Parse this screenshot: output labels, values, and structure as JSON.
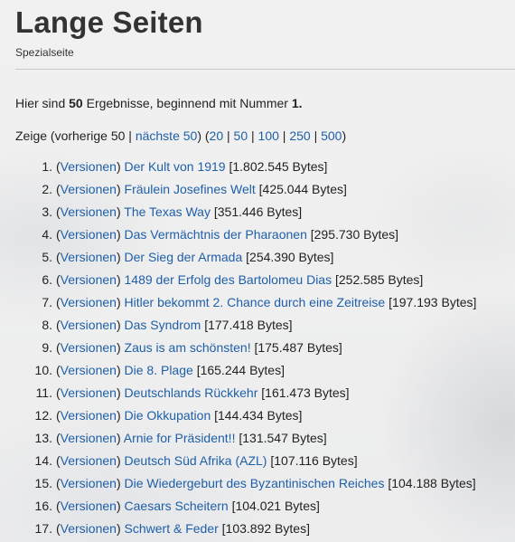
{
  "page": {
    "title": "Lange Seiten",
    "subtitle": "Spezialseite"
  },
  "summary": {
    "prefix": "Hier sind ",
    "count": "50",
    "middle": " Ergebnisse, beginnend mit Nummer ",
    "start": "1",
    "suffix": "."
  },
  "nav": {
    "show": "Zeige (vorherige 50 | ",
    "next_label": "nächste 50",
    "mid": ") (",
    "sep": " | ",
    "limits": [
      "20",
      "50",
      "100",
      "250",
      "500"
    ],
    "end": ")"
  },
  "results": [
    {
      "num": "1.",
      "versions": "Versionen",
      "title": "Der Kult von 1919",
      "size": "[1.802.545 Bytes]"
    },
    {
      "num": "2.",
      "versions": "Versionen",
      "title": "Fräulein Josefines Welt",
      "size": "[425.044 Bytes]"
    },
    {
      "num": "3.",
      "versions": "Versionen",
      "title": "The Texas Way",
      "size": "[351.446 Bytes]"
    },
    {
      "num": "4.",
      "versions": "Versionen",
      "title": "Das Vermächtnis der Pharaonen",
      "size": "[295.730 Bytes]"
    },
    {
      "num": "5.",
      "versions": "Versionen",
      "title": "Der Sieg der Armada",
      "size": "[254.390 Bytes]"
    },
    {
      "num": "6.",
      "versions": "Versionen",
      "title": "1489 der Erfolg des Bartolomeu Dias",
      "size": "[252.585 Bytes]"
    },
    {
      "num": "7.",
      "versions": "Versionen",
      "title": "Hitler bekommt 2. Chance durch eine Zeitreise",
      "size": "[197.193 Bytes]"
    },
    {
      "num": "8.",
      "versions": "Versionen",
      "title": "Das Syndrom",
      "size": "[177.418 Bytes]"
    },
    {
      "num": "9.",
      "versions": "Versionen",
      "title": "Zaus is am schönsten!",
      "size": "[175.487 Bytes]"
    },
    {
      "num": "10.",
      "versions": "Versionen",
      "title": "Die 8. Plage",
      "size": "[165.244 Bytes]"
    },
    {
      "num": "11.",
      "versions": "Versionen",
      "title": "Deutschlands Rückkehr",
      "size": "[161.473 Bytes]"
    },
    {
      "num": "12.",
      "versions": "Versionen",
      "title": "Die Okkupation",
      "size": "[144.434 Bytes]"
    },
    {
      "num": "13.",
      "versions": "Versionen",
      "title": "Arnie for Präsident!!",
      "size": "[131.547 Bytes]"
    },
    {
      "num": "14.",
      "versions": "Versionen",
      "title": "Deutsch Süd Afrika (AZL)",
      "size": "[107.116 Bytes]"
    },
    {
      "num": "15.",
      "versions": "Versionen",
      "title": "Die Wiedergeburt des Byzantinischen Reiches",
      "size": "[104.188 Bytes]"
    },
    {
      "num": "16.",
      "versions": "Versionen",
      "title": "Caesars Scheitern",
      "size": "[104.021 Bytes]"
    },
    {
      "num": "17.",
      "versions": "Versionen",
      "title": "Schwert & Feder",
      "size": "[103.892 Bytes]"
    }
  ]
}
